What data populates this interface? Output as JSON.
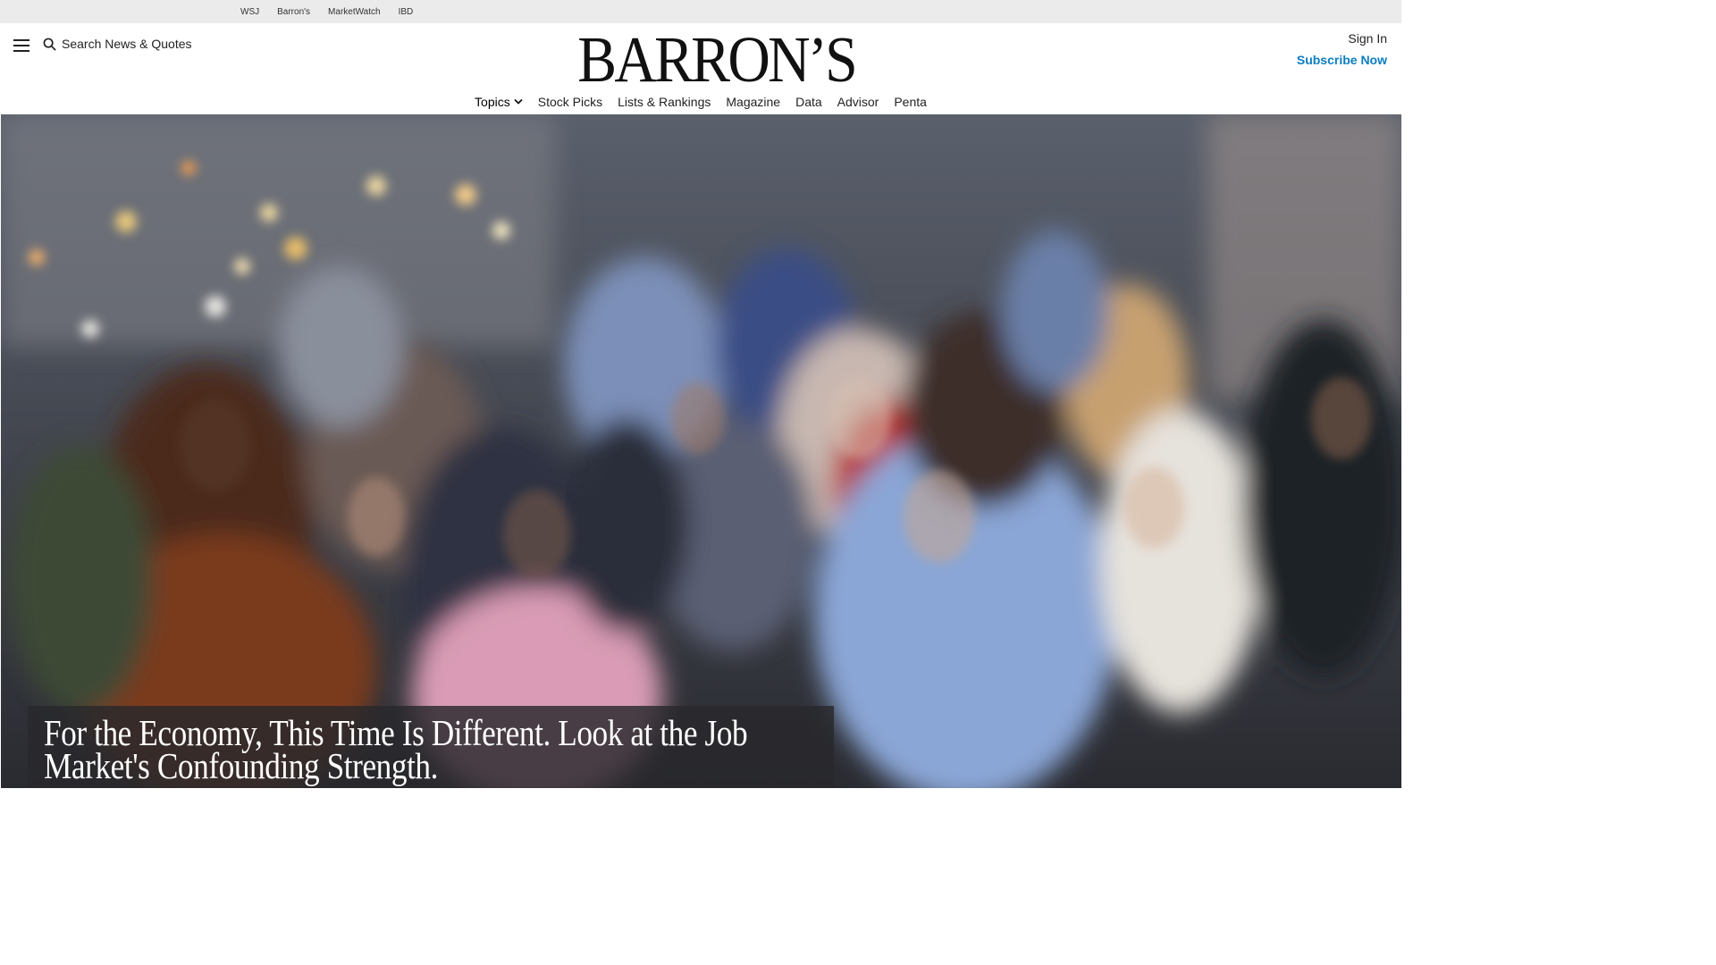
{
  "network": {
    "links": [
      "WSJ",
      "Barron's",
      "MarketWatch",
      "IBD"
    ]
  },
  "header": {
    "search_label": "Search News & Quotes",
    "logo": "BARRON’S",
    "sign_in": "Sign In",
    "subscribe": "Subscribe Now"
  },
  "nav": {
    "items": [
      "Topics",
      "Stock Picks",
      "Lists & Rankings",
      "Magazine",
      "Data",
      "Advisor",
      "Penta"
    ]
  },
  "hero": {
    "headline": "For the Economy, This Time Is Different. Look at the Job Market's Confounding Strength."
  },
  "colors": {
    "accent": "#0b7dc1",
    "network_bar": "#ebebeb"
  },
  "icons": {
    "menu": "hamburger-menu-icon",
    "search": "search-icon",
    "topics_dropdown": "chevron-down-icon"
  }
}
